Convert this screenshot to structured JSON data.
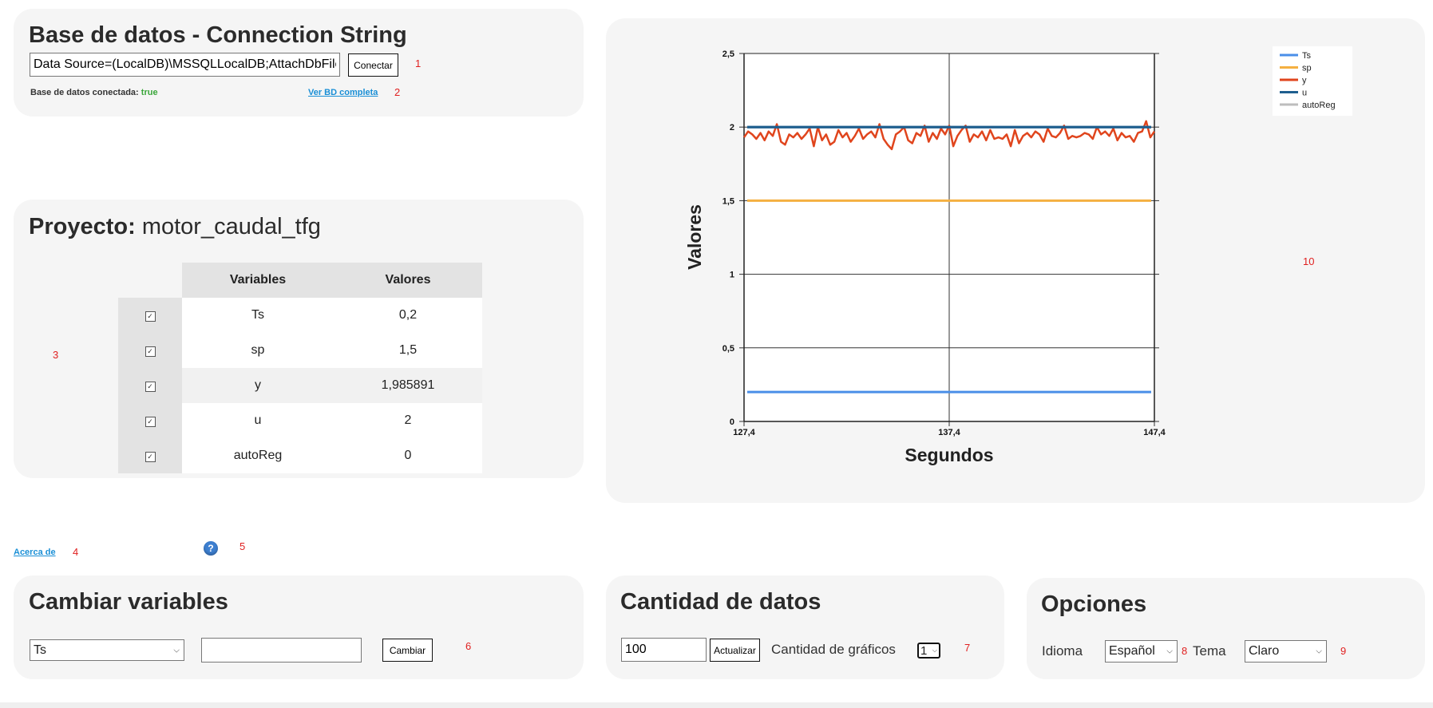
{
  "db": {
    "title": "Base de datos - Connection String",
    "connection_value": "Data Source=(LocalDB)\\MSSQLLocalDB;AttachDbFilename=",
    "connect_label": "Conectar",
    "status_label": "Base de datos conectada:",
    "status_value": "true",
    "view_link": "Ver BD completa"
  },
  "project": {
    "label": "Proyecto:",
    "name": "motor_caudal_tfg",
    "col_variables": "Variables",
    "col_valores": "Valores",
    "rows": [
      {
        "variable": "Ts",
        "valor": "0,2"
      },
      {
        "variable": "sp",
        "valor": "1,5"
      },
      {
        "variable": "y",
        "valor": "1,985891"
      },
      {
        "variable": "u",
        "valor": "2"
      },
      {
        "variable": "autoReg",
        "valor": "0"
      }
    ]
  },
  "about": {
    "link": "Acerca de",
    "help_icon": "question-circle-icon"
  },
  "change": {
    "title": "Cambiar variables",
    "select_value": "Ts",
    "input_value": "",
    "button": "Cambiar"
  },
  "data_amount": {
    "title": "Cantidad de datos",
    "input_value": "100",
    "button": "Actualizar",
    "charts_label": "Cantidad de gráficos",
    "charts_value": "1"
  },
  "options": {
    "title": "Opciones",
    "language_label": "Idioma",
    "language_value": "Español",
    "theme_label": "Tema",
    "theme_value": "Claro"
  },
  "markers": [
    "1",
    "2",
    "3",
    "4",
    "5",
    "6",
    "7",
    "8",
    "9",
    "10"
  ],
  "colors": {
    "Ts": "#4a8fe8",
    "sp": "#f5b041",
    "y": "#e0451d",
    "u": "#1f5f8f",
    "autoReg": "#bdbdbd"
  },
  "chart_data": {
    "type": "line",
    "xlabel": "Segundos",
    "ylabel": "Valores",
    "xlim": [
      127.4,
      147.4
    ],
    "ylim": [
      0,
      2.5
    ],
    "x_ticks": [
      "127,4",
      "137,4",
      "147,4"
    ],
    "y_ticks": [
      "0",
      "0,5",
      "1",
      "1,5",
      "2",
      "2,5"
    ],
    "grid": true,
    "legend_position": "top-right",
    "series": [
      {
        "name": "Ts",
        "constant": 0.2
      },
      {
        "name": "sp",
        "constant": 1.5
      },
      {
        "name": "y",
        "values": [
          1.93,
          1.97,
          1.95,
          1.92,
          1.96,
          1.91,
          1.97,
          1.94,
          2.02,
          1.9,
          1.88,
          1.95,
          1.93,
          1.96,
          1.92,
          1.95,
          1.99,
          1.87,
          2.0,
          1.91,
          1.95,
          1.88,
          1.9,
          1.98,
          1.93,
          1.96,
          1.9,
          1.94,
          1.99,
          1.92,
          1.95,
          1.97,
          1.93,
          2.02,
          1.92,
          1.88,
          1.85,
          1.95,
          1.97,
          2.0,
          1.91,
          1.89,
          1.96,
          1.94,
          2.01,
          1.9,
          1.96,
          1.92,
          1.99,
          1.95,
          2.01,
          1.87,
          1.94,
          1.98,
          2.01,
          1.9,
          1.95,
          1.93,
          1.97,
          1.91,
          1.98,
          1.92,
          1.93,
          1.92,
          1.95,
          1.87,
          1.98,
          1.89,
          1.94,
          1.96,
          1.93,
          1.97,
          1.95,
          1.9,
          1.99,
          1.94,
          1.93,
          1.96,
          2.01,
          1.92,
          1.94,
          1.93,
          1.94,
          1.96,
          1.95,
          1.92,
          2.0,
          1.95,
          1.97,
          1.94,
          1.99,
          1.91,
          1.96,
          1.93,
          1.94,
          1.9,
          1.96,
          1.97,
          2.04,
          1.93,
          1.97
        ]
      },
      {
        "name": "u",
        "constant": 2.0
      },
      {
        "name": "autoReg",
        "constant": 0
      }
    ]
  }
}
